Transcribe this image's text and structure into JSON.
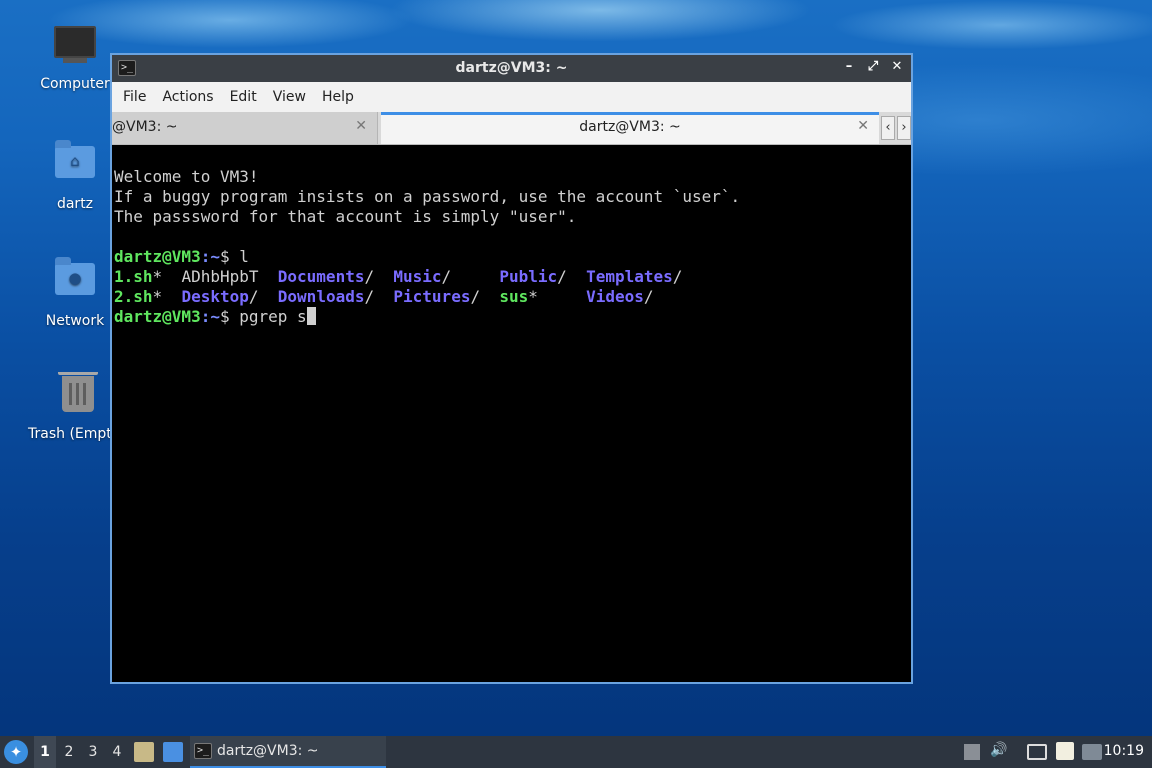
{
  "desktop": {
    "icons": [
      {
        "label": "Computer",
        "icon": "computer-icon"
      },
      {
        "label": "dartz",
        "icon": "home-folder-icon"
      },
      {
        "label": "Network",
        "icon": "network-folder-icon"
      },
      {
        "label": "Trash (Empt",
        "icon": "trash-icon"
      }
    ]
  },
  "window": {
    "title": "dartz@VM3: ~",
    "controls": {
      "minimize": "–",
      "maximize": "⤢",
      "close": "✕"
    },
    "menu": [
      "File",
      "Actions",
      "Edit",
      "View",
      "Help"
    ],
    "tabs": [
      {
        "label": "@VM3: ~",
        "active": false
      },
      {
        "label": "dartz@VM3: ~",
        "active": true
      }
    ],
    "tab_nav": {
      "prev": "‹",
      "next": "›"
    }
  },
  "terminal": {
    "welcome": [
      "Welcome to VM3!",
      "If a buggy program insists on a password, use the account `user`.",
      "The passsword for that account is simply \"user\"."
    ],
    "prompt_user": "dartz@VM3",
    "prompt_path": ":~",
    "prompt_symbol": "$ ",
    "cmd1": "l",
    "ls_row1": [
      {
        "name": "1.sh",
        "suffix": "*",
        "kind": "exec"
      },
      {
        "name": "ADhbHpbT",
        "suffix": "",
        "kind": "file"
      },
      {
        "name": "Documents",
        "suffix": "/",
        "kind": "dir"
      },
      {
        "name": "Music",
        "suffix": "/",
        "kind": "dir"
      },
      {
        "name": "Public",
        "suffix": "/",
        "kind": "dir"
      },
      {
        "name": "Templates",
        "suffix": "/",
        "kind": "dir"
      }
    ],
    "ls_row2": [
      {
        "name": "2.sh",
        "suffix": "*",
        "kind": "exec"
      },
      {
        "name": "Desktop",
        "suffix": "/",
        "kind": "dir"
      },
      {
        "name": "Downloads",
        "suffix": "/",
        "kind": "dir"
      },
      {
        "name": "Pictures",
        "suffix": "/",
        "kind": "dir"
      },
      {
        "name": "sus",
        "suffix": "*",
        "kind": "exec"
      },
      {
        "name": "Videos",
        "suffix": "/",
        "kind": "dir"
      }
    ],
    "cmd2": "pgrep s"
  },
  "taskbar": {
    "workspaces": [
      "1",
      "2",
      "3",
      "4"
    ],
    "active_workspace": "1",
    "task_label": "dartz@VM3: ~",
    "clock": "10:19"
  },
  "colors": {
    "accent": "#3d8ee6",
    "exec_green": "#5fe65f",
    "dir_blue": "#7a6cff"
  }
}
